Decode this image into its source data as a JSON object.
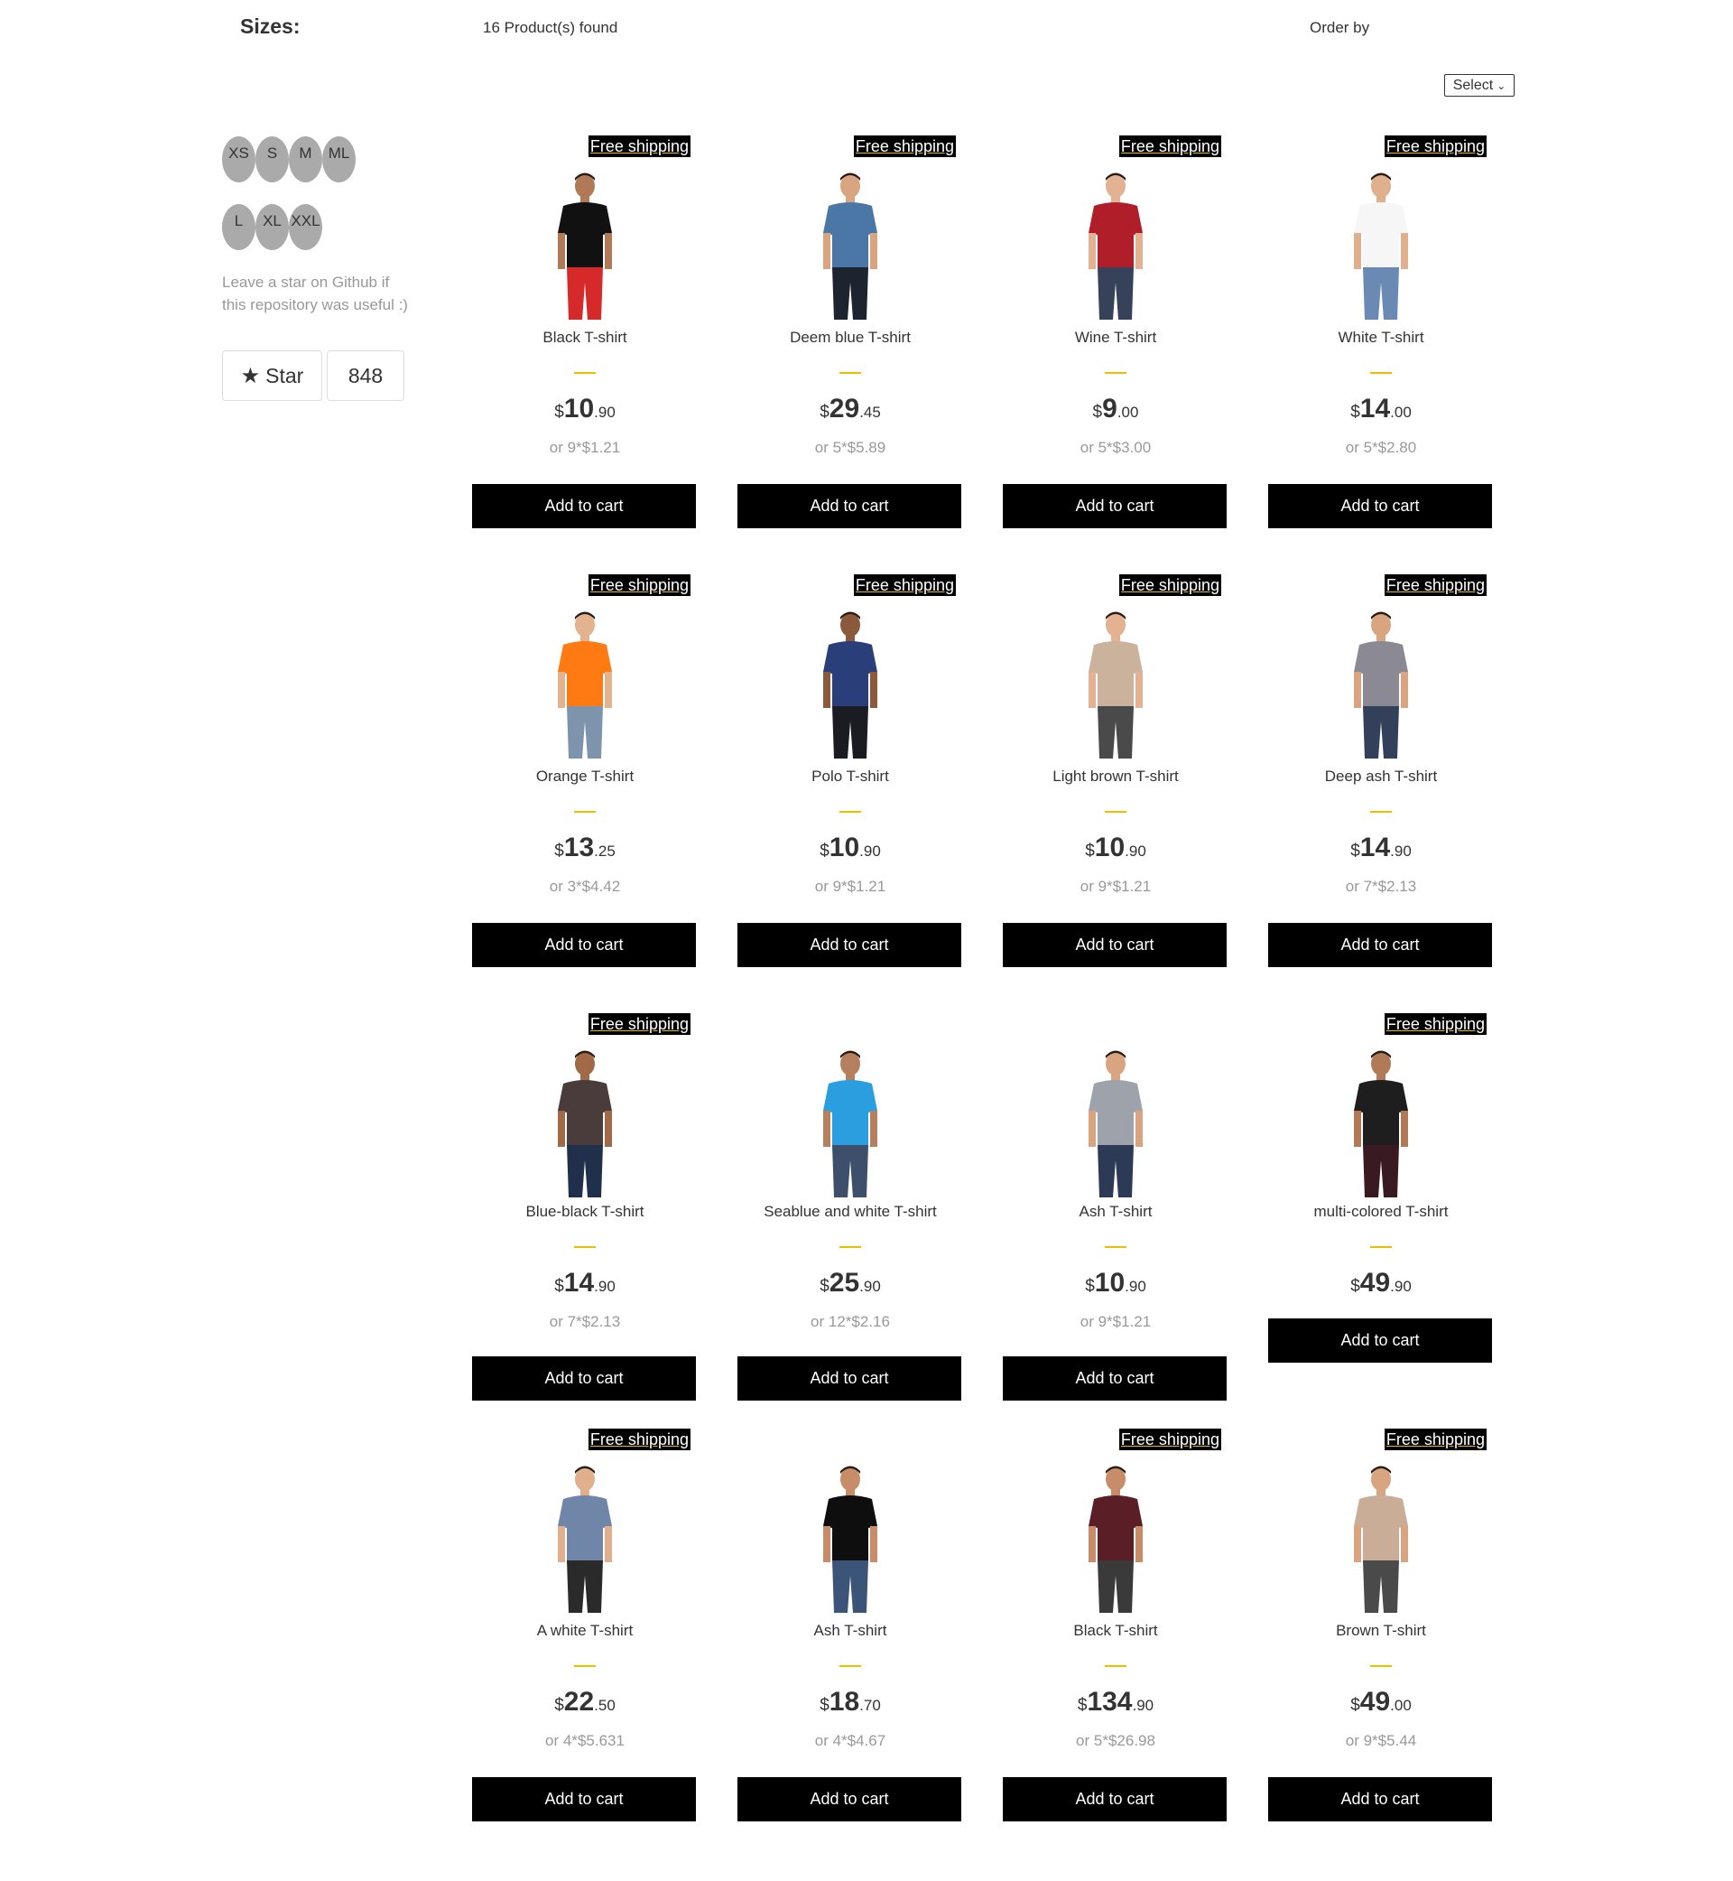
{
  "filters": {
    "title": "Sizes:",
    "sizes_row1": [
      "XS",
      "S",
      "M",
      "ML"
    ],
    "sizes_row2": [
      "L",
      "XL",
      "XXL"
    ]
  },
  "github": {
    "text": "Leave a star on Github if this repository was useful :)",
    "star_label": "Star",
    "star_count": "848"
  },
  "shelf": {
    "products_found": "16 Product(s) found",
    "order_by_label": "Order by",
    "order_select_value": "Select"
  },
  "badge_text": "Free shipping",
  "cart_label": "Add to cart",
  "currency": "$",
  "products": [
    {
      "name": "Black T-shirt",
      "free_shipping": true,
      "price_int": "10",
      "price_dec": ".90",
      "installment": "or 9*$1.21",
      "colors": {
        "shirt": "#111111",
        "pants": "#d62a2a",
        "skin": "#b07a56"
      }
    },
    {
      "name": "Deem blue T-shirt",
      "free_shipping": true,
      "price_int": "29",
      "price_dec": ".45",
      "installment": "or 5*$5.89",
      "colors": {
        "shirt": "#4a77a6",
        "pants": "#1d2430",
        "skin": "#d9a580"
      }
    },
    {
      "name": "Wine T-shirt",
      "free_shipping": true,
      "price_int": "9",
      "price_dec": ".00",
      "installment": "or 5*$3.00",
      "colors": {
        "shirt": "#b01e2a",
        "pants": "#36425a",
        "skin": "#e2b292"
      }
    },
    {
      "name": "White T-shirt",
      "free_shipping": true,
      "price_int": "14",
      "price_dec": ".00",
      "installment": "or 5*$2.80",
      "colors": {
        "shirt": "#f6f6f6",
        "pants": "#6a8ab3",
        "skin": "#e0b08e"
      }
    },
    {
      "name": "Orange T-shirt",
      "free_shipping": true,
      "price_int": "13",
      "price_dec": ".25",
      "installment": "or 3*$4.42",
      "colors": {
        "shirt": "#ff7a12",
        "pants": "#7e94ad",
        "skin": "#e3b28e"
      }
    },
    {
      "name": "Polo T-shirt",
      "free_shipping": true,
      "price_int": "10",
      "price_dec": ".90",
      "installment": "or 9*$1.21",
      "colors": {
        "shirt": "#2a3f7a",
        "pants": "#1b1b22",
        "skin": "#8b5a3c"
      }
    },
    {
      "name": "Light brown T-shirt",
      "free_shipping": true,
      "price_int": "10",
      "price_dec": ".90",
      "installment": "or 9*$1.21",
      "colors": {
        "shirt": "#cbb29c",
        "pants": "#4a4a4a",
        "skin": "#e2b292"
      }
    },
    {
      "name": "Deep ash T-shirt",
      "free_shipping": true,
      "price_int": "14",
      "price_dec": ".90",
      "installment": "or 7*$2.13",
      "colors": {
        "shirt": "#8b8a94",
        "pants": "#32405a",
        "skin": "#d9a580"
      }
    },
    {
      "name": "Blue-black T-shirt",
      "free_shipping": true,
      "price_int": "14",
      "price_dec": ".90",
      "installment": "or 7*$2.13",
      "colors": {
        "shirt": "#4a3c3a",
        "pants": "#20304a",
        "skin": "#a06a46"
      }
    },
    {
      "name": "Seablue and white T-shirt",
      "free_shipping": false,
      "price_int": "25",
      "price_dec": ".90",
      "installment": "or 12*$2.16",
      "colors": {
        "shirt": "#2b9ee0",
        "pants": "#3d4f6a",
        "skin": "#b5805d"
      }
    },
    {
      "name": "Ash T-shirt",
      "free_shipping": false,
      "price_int": "10",
      "price_dec": ".90",
      "installment": "or 9*$1.21",
      "colors": {
        "shirt": "#9ea2aa",
        "pants": "#2d3a56",
        "skin": "#d9a580"
      }
    },
    {
      "name": "multi-colored T-shirt",
      "free_shipping": true,
      "price_int": "49",
      "price_dec": ".90",
      "installment": "",
      "colors": {
        "shirt": "#1e1e1e",
        "pants": "#3a1a22",
        "skin": "#b07a56"
      }
    },
    {
      "name": "A white T-shirt",
      "free_shipping": true,
      "price_int": "22",
      "price_dec": ".50",
      "installment": "or 4*$5.631",
      "colors": {
        "shirt": "#6f86a8",
        "pants": "#2a2a2a",
        "skin": "#e0b08e"
      }
    },
    {
      "name": "Ash T-shirt",
      "free_shipping": false,
      "price_int": "18",
      "price_dec": ".70",
      "installment": "or 4*$4.67",
      "colors": {
        "shirt": "#0e0e0e",
        "pants": "#3c5478",
        "skin": "#c68d68"
      }
    },
    {
      "name": "Black T-shirt",
      "free_shipping": true,
      "price_int": "134",
      "price_dec": ".90",
      "installment": "or 5*$26.98",
      "colors": {
        "shirt": "#5a1f26",
        "pants": "#3a3a3a",
        "skin": "#c68d68"
      }
    },
    {
      "name": "Brown T-shirt",
      "free_shipping": true,
      "price_int": "49",
      "price_dec": ".00",
      "installment": "or 9*$5.44",
      "colors": {
        "shirt": "#c9ad97",
        "pants": "#4a4a4a",
        "skin": "#d9a580"
      }
    }
  ]
}
